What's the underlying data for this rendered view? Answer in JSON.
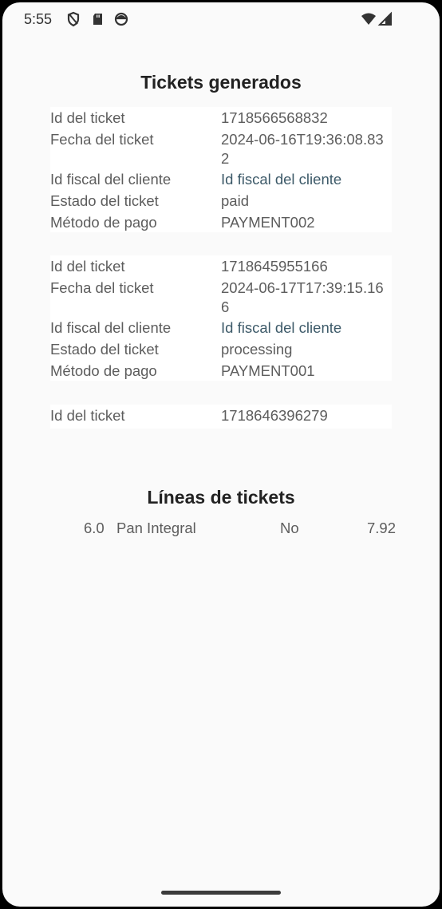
{
  "status_bar": {
    "time": "5:55"
  },
  "tickets_section": {
    "title": "Tickets generados",
    "tickets": [
      {
        "id_label": "Id del ticket",
        "id_value": "1718566568832",
        "fecha_label": "Fecha del ticket",
        "fecha_value": "2024-06-16T19:36:08.832",
        "fiscal_label": "Id fiscal del cliente",
        "fiscal_value": "Id fiscal del cliente",
        "estado_label": "Estado del ticket",
        "estado_value": "paid",
        "pago_label": "Método de pago",
        "pago_value": "PAYMENT002"
      },
      {
        "id_label": "Id del ticket",
        "id_value": "1718645955166",
        "fecha_label": "Fecha del ticket",
        "fecha_value": "2024-06-17T17:39:15.166",
        "fiscal_label": "Id fiscal del cliente",
        "fiscal_value": "Id fiscal del cliente",
        "estado_label": "Estado del ticket",
        "estado_value": "processing",
        "pago_label": "Método de pago",
        "pago_value": "PAYMENT001"
      },
      {
        "id_label": "Id del ticket",
        "id_value": "1718646396279"
      }
    ]
  },
  "lines_section": {
    "title": "Líneas de tickets",
    "lines": [
      {
        "quantity": "6.0",
        "product": "Pan Integral",
        "flag": "No",
        "price": "7.92"
      }
    ]
  }
}
